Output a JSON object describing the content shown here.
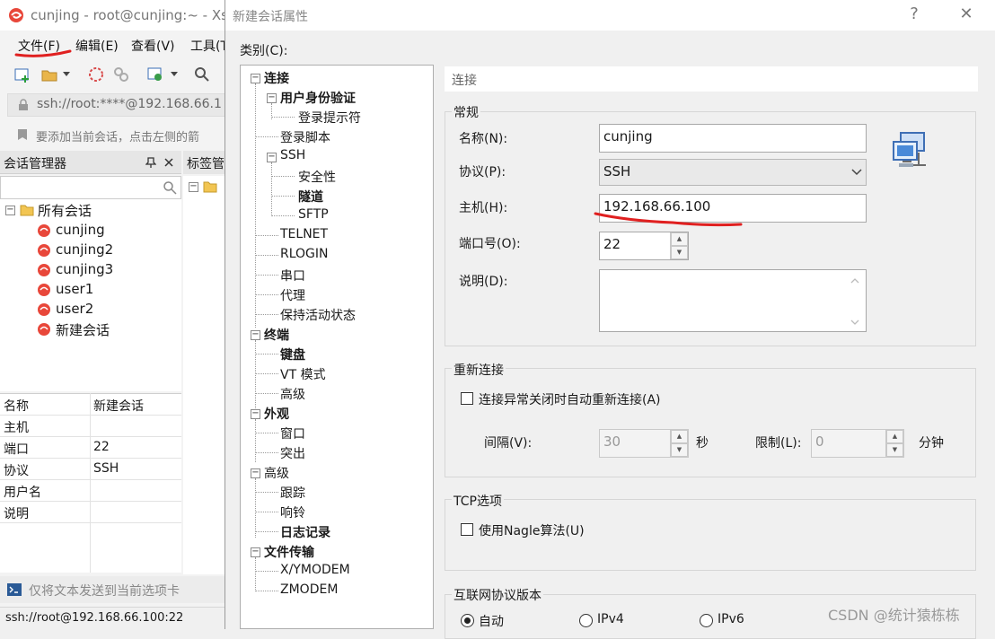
{
  "xshell": {
    "title": "cunjing - root@cunjing:~ - Xsl",
    "menu": [
      "文件(F)",
      "编辑(E)",
      "查看(V)",
      "工具(T"
    ],
    "address": "ssh://root:****@192.168.66.1",
    "hint": "要添加当前会话，点击左侧的箭",
    "session_manager_title": "会话管理器",
    "tag_manager_title": "标签管",
    "tree_root": "所有会话",
    "sessions": [
      "cunjing",
      "cunjing2",
      "cunjing3",
      "user1",
      "user2",
      "新建会话"
    ],
    "properties": [
      {
        "k": "名称",
        "v": "新建会话"
      },
      {
        "k": "主机",
        "v": ""
      },
      {
        "k": "端口",
        "v": "22"
      },
      {
        "k": "协议",
        "v": "SSH"
      },
      {
        "k": "用户名",
        "v": ""
      },
      {
        "k": "说明",
        "v": ""
      }
    ],
    "send_bar": "仅将文本发送到当前选项卡",
    "status": "ssh://root@192.168.66.100:22"
  },
  "dialog": {
    "title": "新建会话属性",
    "help": "?",
    "close": "✕",
    "category_label": "类别(C):",
    "tree": {
      "connection": "连接",
      "auth": "用户身份验证",
      "login_prompt": "登录提示符",
      "login_script": "登录脚本",
      "ssh": "SSH",
      "security": "安全性",
      "tunnel": "隧道",
      "sftp": "SFTP",
      "telnet": "TELNET",
      "rlogin": "RLOGIN",
      "serial": "串口",
      "proxy": "代理",
      "keepalive": "保持活动状态",
      "terminal": "终端",
      "keyboard": "键盘",
      "vt_mode": "VT 模式",
      "advanced_t": "高级",
      "appearance": "外观",
      "window": "窗口",
      "highlight": "突出",
      "advanced": "高级",
      "trace": "跟踪",
      "bell": "响铃",
      "logging": "日志记录",
      "file_transfer": "文件传输",
      "xymodem": "X/YMODEM",
      "zmodem": "ZMODEM"
    },
    "section_title": "连接",
    "general": {
      "label": "常规",
      "name_label": "名称(N):",
      "name_value": "cunjing",
      "protocol_label": "协议(P):",
      "protocol_value": "SSH",
      "host_label": "主机(H):",
      "host_value": "192.168.66.100",
      "port_label": "端口号(O):",
      "port_value": "22",
      "desc_label": "说明(D):"
    },
    "reconnect": {
      "label": "重新连接",
      "auto_label": "连接异常关闭时自动重新连接(A)",
      "interval_label": "间隔(V):",
      "interval_value": "30",
      "seconds": "秒",
      "limit_label": "限制(L):",
      "limit_value": "0",
      "minutes": "分钟"
    },
    "tcp": {
      "label": "TCP选项",
      "nagle_label": "使用Nagle算法(U)"
    },
    "ip_version": {
      "label": "互联网协议版本",
      "auto": "自动",
      "ipv4": "IPv4",
      "ipv6": "IPv6"
    }
  },
  "watermark": "CSDN @统计猿栋栋"
}
